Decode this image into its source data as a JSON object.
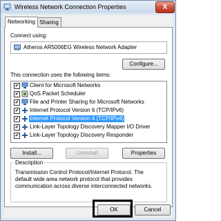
{
  "window": {
    "title": "Wireless Network Connection Properties",
    "close_label": "X"
  },
  "tabs": [
    {
      "label": "Networking",
      "active": true
    },
    {
      "label": "Sharing",
      "active": false
    }
  ],
  "connect": {
    "label": "Connect using:",
    "adapter": "Atheros AR5006EG Wireless Network Adapter",
    "configure_label": "Configure..."
  },
  "items_label": "This connection uses the following items:",
  "items": [
    {
      "label": "Client for Microsoft Networks",
      "checked": true,
      "icon": "network-client-icon"
    },
    {
      "label": "QoS Packet Scheduler",
      "checked": true,
      "icon": "network-service-icon"
    },
    {
      "label": "File and Printer Sharing for Microsoft Networks",
      "checked": true,
      "icon": "network-client-icon"
    },
    {
      "label": "Internet Protocol Version 6 (TCP/IPv6)",
      "checked": true,
      "icon": "protocol-icon"
    },
    {
      "label": "Internet Protocol Version 4 (TCP/IPv4)",
      "checked": true,
      "icon": "protocol-icon",
      "selected": true
    },
    {
      "label": "Link-Layer Topology Discovery Mapper I/O Driver",
      "checked": true,
      "icon": "protocol-icon"
    },
    {
      "label": "Link-Layer Topology Discovery Responder",
      "checked": true,
      "icon": "protocol-icon"
    }
  ],
  "buttons": {
    "install": "Install...",
    "uninstall": "Uninstall",
    "properties": "Properties",
    "ok": "OK",
    "cancel": "Cancel"
  },
  "description": {
    "title": "Description",
    "text": "Transmission Control Protocol/Internet Protocol. The default wide area network protocol that provides communication across diverse interconnected networks."
  },
  "colors": {
    "selection": "#3399ff",
    "close_button": "#c94f38",
    "titlebar": "#cbd9ea"
  }
}
